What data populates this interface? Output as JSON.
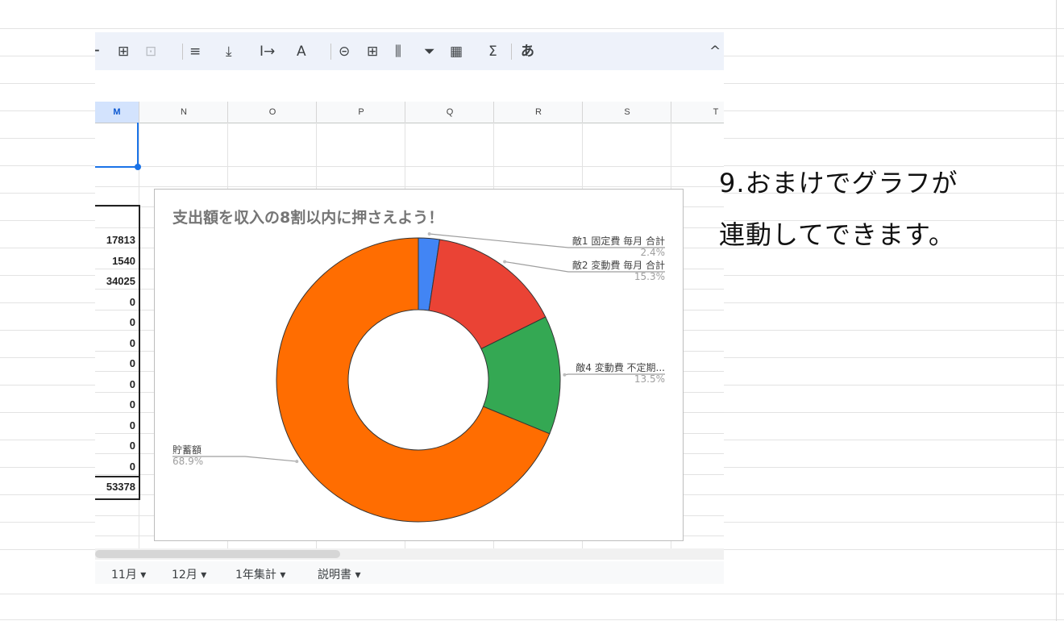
{
  "toolbar": {
    "items": [
      "⊞",
      "⊡",
      "≡",
      "⤓",
      "I→",
      "A",
      "⊝",
      "⊞",
      "⫼",
      "⏷",
      "▦",
      "Σ",
      "あ"
    ],
    "collapse_icon": "^"
  },
  "columns": [
    "M",
    "N",
    "O",
    "P",
    "Q",
    "R",
    "S",
    "T"
  ],
  "values": [
    "17813",
    "1540",
    "34025",
    "0",
    "0",
    "0",
    "0",
    "0",
    "0",
    "0",
    "0",
    "0"
  ],
  "total": "53378",
  "chart_data": {
    "type": "pie",
    "donut": true,
    "title": "支出額を収入の8割以内に押さえよう！",
    "slices": [
      {
        "label": "敵1 固定費 毎月 合計",
        "percent_text": "2.4%",
        "value": 2.4,
        "color": "#4285f4"
      },
      {
        "label": "敵2 変動費 毎月 合計",
        "percent_text": "15.3%",
        "value": 15.3,
        "color": "#ea4335"
      },
      {
        "label": "敵4 変動費 不定期...",
        "percent_text": "13.5%",
        "value": 13.5,
        "color": "#34a853"
      },
      {
        "label": "貯蓄額",
        "percent_text": "68.9%",
        "value": 68.8,
        "color": "#ff6d01"
      }
    ]
  },
  "sheet_tabs": [
    "11月",
    "12月",
    "1年集計",
    "説明書"
  ],
  "note": {
    "line1": "9.おまけでグラフが",
    "line2": "連動してできます。"
  }
}
